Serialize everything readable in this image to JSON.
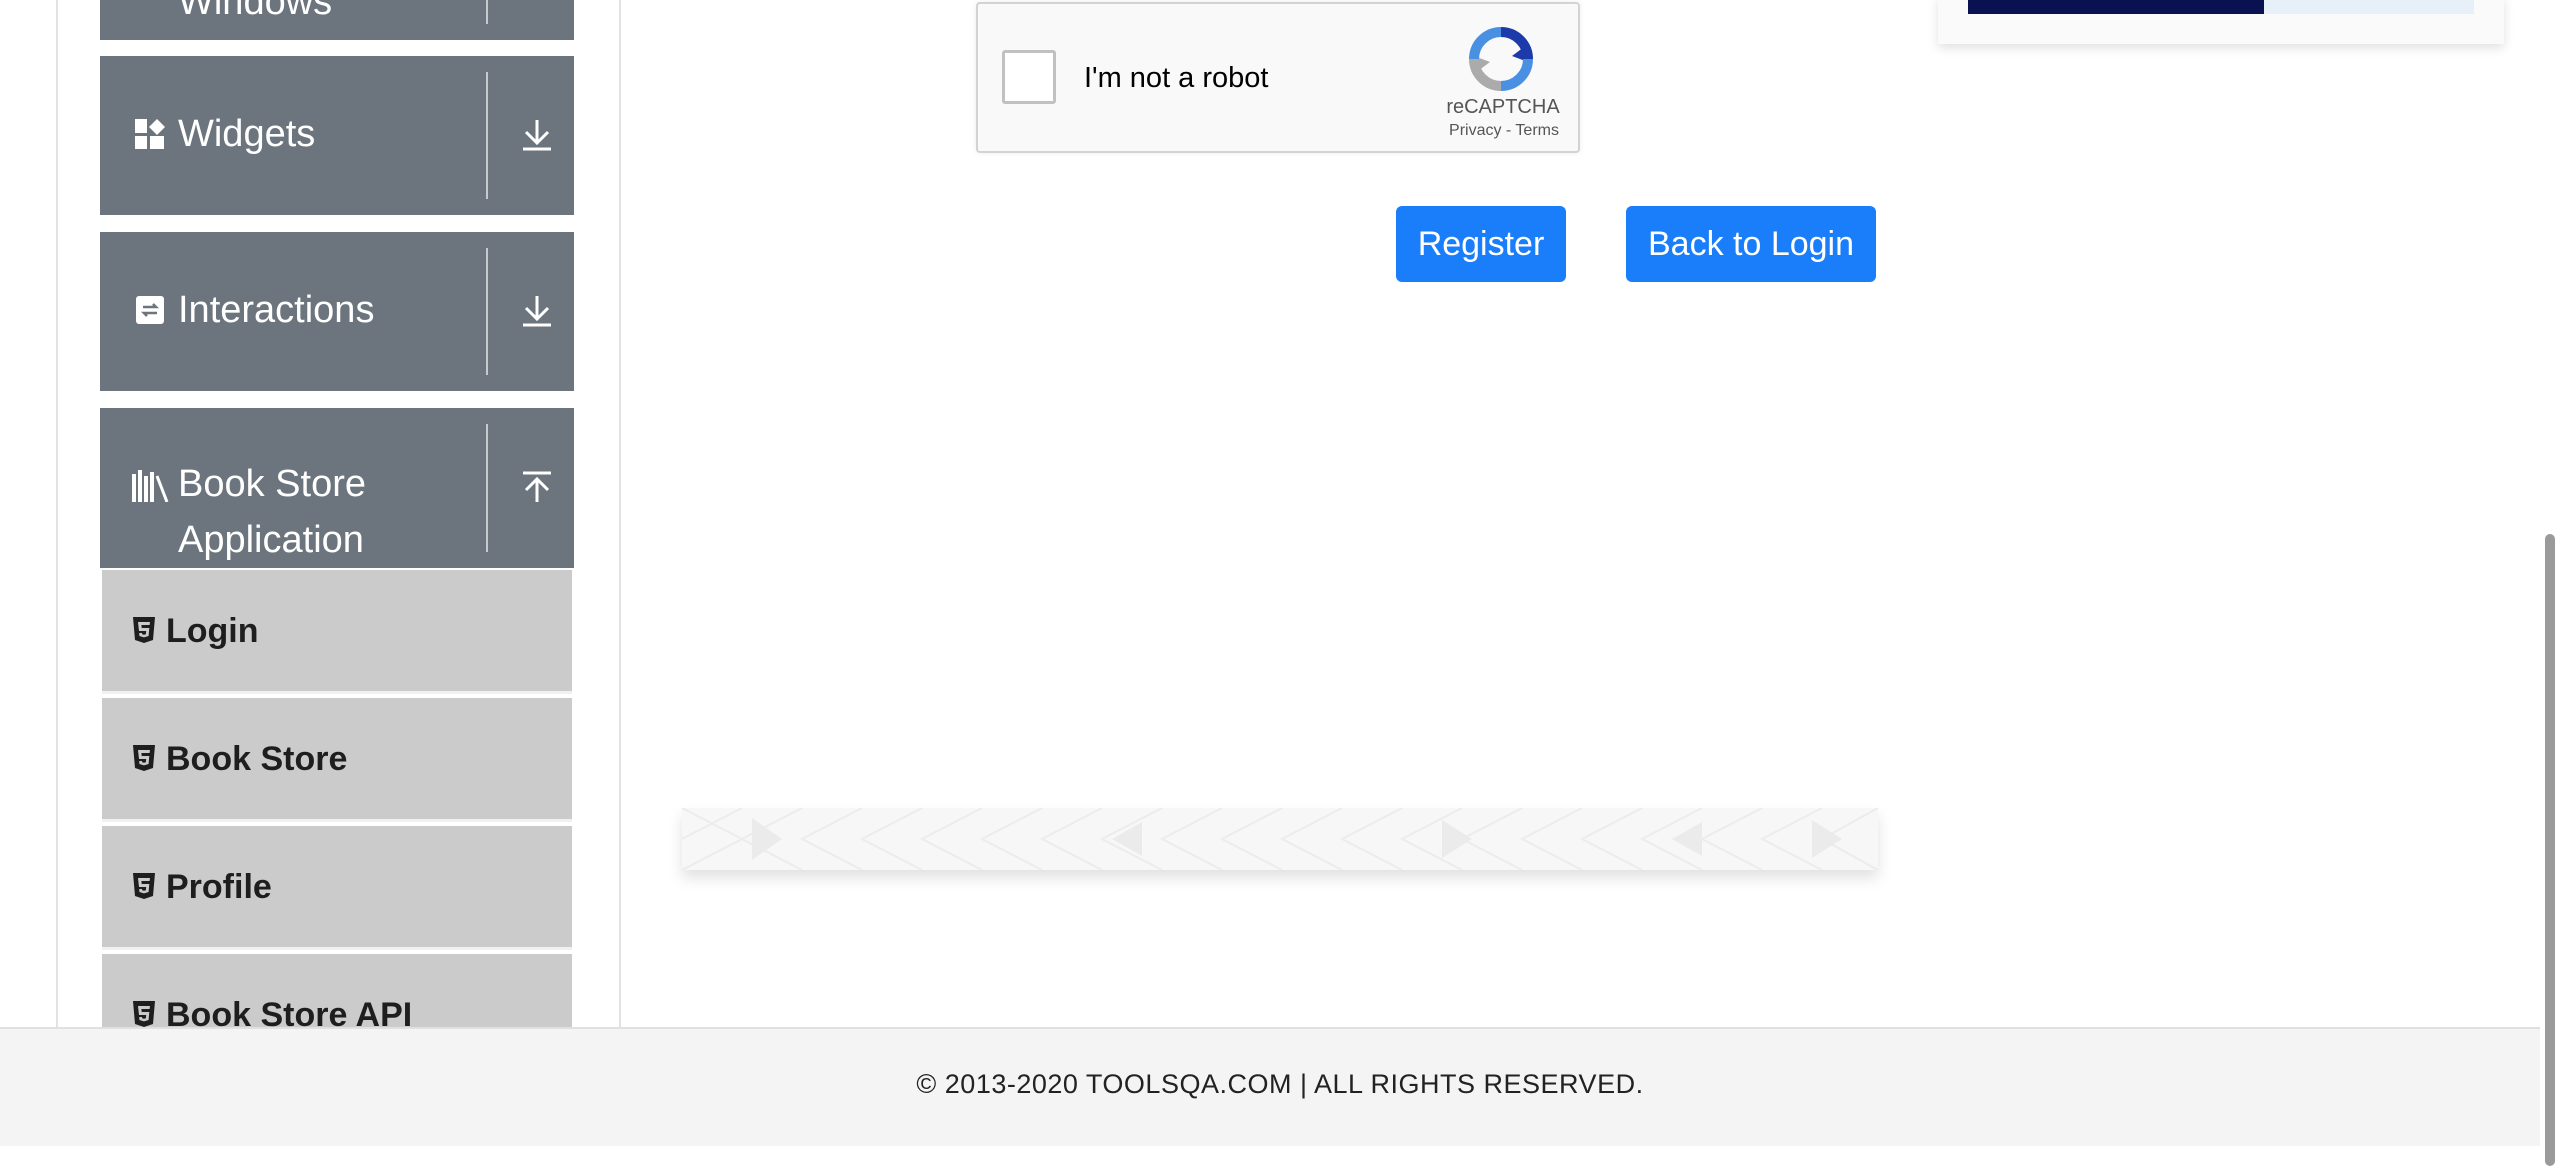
{
  "sidebar": {
    "groups": [
      {
        "title": "Windows",
        "icon": "window-icon",
        "arrow": "download-arrow-icon"
      },
      {
        "title": "Widgets",
        "icon": "widgets-icon",
        "arrow": "download-arrow-icon"
      },
      {
        "title": "Interactions",
        "icon": "interactions-icon",
        "arrow": "download-arrow-icon"
      },
      {
        "title_line1": "Book Store",
        "title_line2": "Application",
        "icon": "books-icon",
        "arrow": "upload-arrow-icon"
      }
    ],
    "items": [
      {
        "label": "Login",
        "icon": "html5-icon"
      },
      {
        "label": "Book Store",
        "icon": "html5-icon"
      },
      {
        "label": "Profile",
        "icon": "html5-icon"
      },
      {
        "label": "Book Store API",
        "icon": "html5-icon"
      }
    ]
  },
  "recaptcha": {
    "label": "I'm not a robot",
    "brand": "reCAPTCHA",
    "links": "Privacy - Terms"
  },
  "buttons": {
    "register": "Register",
    "back_to_login": "Back to Login"
  },
  "footer": {
    "text": "© 2013-2020 TOOLSQA.COM | ALL RIGHTS RESERVED."
  },
  "colors": {
    "group_bg": "#6c757d",
    "item_bg": "#cbcbcb",
    "button_bg": "#1a7efb"
  }
}
